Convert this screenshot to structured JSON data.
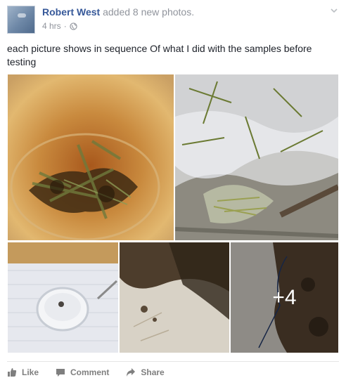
{
  "post": {
    "author": "Robert West",
    "action": "added 8 new photos.",
    "time": "4 hrs",
    "privacy_icon": "globe-icon",
    "menu_icon": "chevron-down-icon",
    "caption": "each picture shows in sequence Of what I did with the samples before testing"
  },
  "photos": {
    "more_count": "+4"
  },
  "actions": {
    "like": "Like",
    "comment": "Comment",
    "share": "Share"
  },
  "colors": {
    "link": "#365899",
    "meta": "#90949c",
    "action": "#7f7f7f"
  }
}
